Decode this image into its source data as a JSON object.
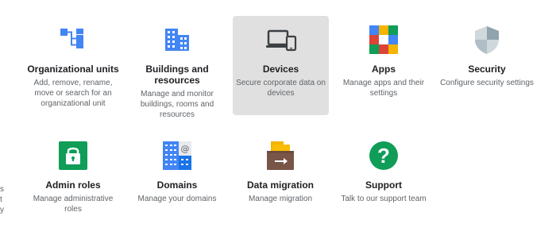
{
  "row1": [
    {
      "title": "Organizational units",
      "desc": "Add, remove, rename, move or search for an organizational unit",
      "icon": "org-units-icon"
    },
    {
      "title": "Buildings and resources",
      "desc": "Manage and monitor buildings, rooms and resources",
      "icon": "buildings-icon"
    },
    {
      "title": "Devices",
      "desc": "Secure corporate data on devices",
      "icon": "devices-icon"
    },
    {
      "title": "Apps",
      "desc": "Manage apps and their settings",
      "icon": "apps-icon"
    },
    {
      "title": "Security",
      "desc": "Configure security settings",
      "icon": "security-shield-icon"
    }
  ],
  "row2": [
    {
      "title": "Admin roles",
      "desc": "Manage administrative roles",
      "icon": "admin-roles-lock-icon"
    },
    {
      "title": "Domains",
      "desc": "Manage your domains",
      "icon": "domains-icon"
    },
    {
      "title": "Data migration",
      "desc": "Manage migration",
      "icon": "data-migration-icon"
    },
    {
      "title": "Support",
      "desc": "Talk to our support team",
      "icon": "support-help-icon"
    }
  ],
  "clipped_left": [
    "s",
    "t",
    "y"
  ],
  "colors": {
    "blue": "#4285f4",
    "green": "#0f9d58",
    "highlight": "#e0e0e0",
    "title": "#202124",
    "desc": "#5f6368"
  }
}
